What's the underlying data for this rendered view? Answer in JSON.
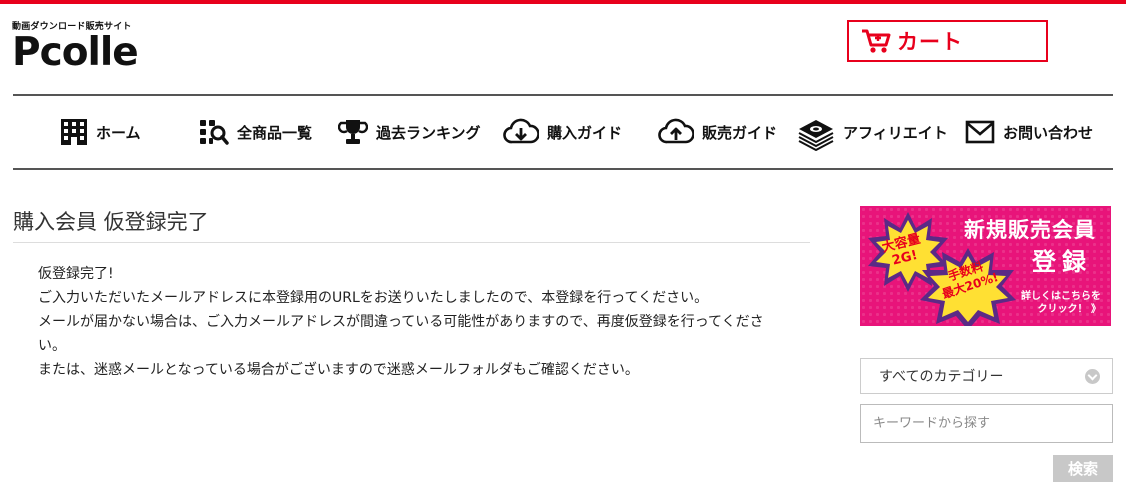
{
  "brand": {
    "tagline": "動画ダウンロード販売サイト",
    "name": "Pcolle",
    "accent": "#e8001c"
  },
  "cart": {
    "label": "カート"
  },
  "nav": {
    "items": [
      {
        "label": "ホーム",
        "icon": "building-icon"
      },
      {
        "label": "全商品一覧",
        "icon": "grid-search-icon"
      },
      {
        "label": "過去ランキング",
        "icon": "trophy-icon"
      },
      {
        "label": "購入ガイド",
        "icon": "cloud-download-icon"
      },
      {
        "label": "販売ガイド",
        "icon": "cloud-upload-icon"
      },
      {
        "label": "アフィリエイト",
        "icon": "money-stack-icon"
      },
      {
        "label": "お問い合わせ",
        "icon": "mail-icon"
      }
    ]
  },
  "main": {
    "title": "購入会員 仮登録完了",
    "lines": [
      "仮登録完了!",
      "ご入力いただいたメールアドレスに本登録用のURLをお送りいたしましたので、本登録を行ってください。",
      "メールが届かない場合は、ご入力メールアドレスが間違っている可能性がありますので、再度仮登録を行ってくださ",
      "い。",
      "または、迷惑メールとなっている場合がございますので迷惑メールフォルダもご確認ください。"
    ]
  },
  "sidebar": {
    "banner": {
      "title1": "新規販売会員",
      "title2": "登録",
      "badge1": "大容量 2G!",
      "badge1_a": "大容量",
      "badge1_b": "2G!",
      "badge2_a": "手数料",
      "badge2_b": "最大20%!",
      "more_a": "詳しくはこちらを",
      "more_b": "クリック！ 》",
      "bg": "#e8147a"
    },
    "category_select": {
      "value": "すべてのカテゴリー"
    },
    "search": {
      "placeholder": "キーワードから探す",
      "button": "検索"
    }
  }
}
